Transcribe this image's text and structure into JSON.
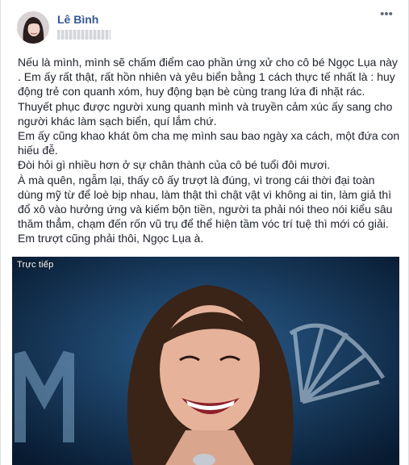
{
  "post": {
    "author": "Lê Bình",
    "more_icon": "more-horizontal-icon",
    "text_lines": [
      "Nếu là mình, mình sẽ chấm điểm cao phần ứng xử cho cô bé Ngọc Lụa này\n. Em ấy rất thật, rất hồn nhiên và yêu biển bằng 1 cách thực tế nhất là : huy động trẻ con quanh xóm, huy động bạn bè cùng trang lứa đi nhặt rác.\nThuyết phục được người xung quanh mình và truyền cảm xúc ấy sang cho người khác làm sạch biển, quí lắm chứ.",
      "Em ấy cũng khao khát ôm cha mẹ mình sau bao ngày xa cách, một đứa con hiếu đễ.",
      "Đòi hỏi gì nhiều hơn ở sự chân thành của cô bé tuổi đôi mươi.",
      "À mà quên, ngẫm lại, thấy cô ấy trượt là đúng, vì trong cái thời đại toàn dùng mỹ từ để loè bịp nhau, làm thật thì chật vật vì không ai tin, làm giả thì đổ xô vào hưởng ứng và kiếm bộn tiền, người ta phải nói theo nói kiểu sâu thăm thẳm, chạm đến rốn vũ trụ để thể hiện tầm vóc trí tuệ thì mới có giải.",
      "Em trượt cũng phải thôi, Ngọc Lụa à."
    ]
  },
  "media": {
    "live_label": "Trực tiếp"
  },
  "colors": {
    "author_link": "#365899",
    "body_text": "#1d2129",
    "stage_blue": "#0d2440"
  }
}
